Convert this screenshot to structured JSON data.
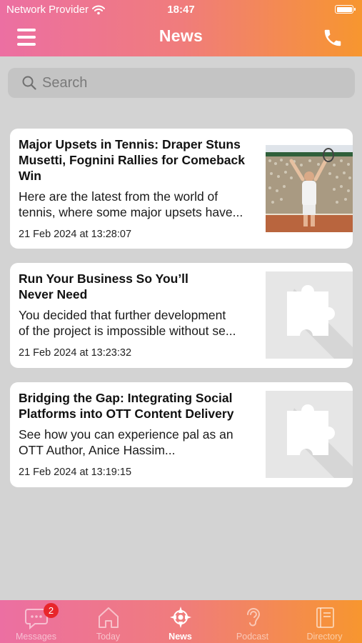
{
  "status_bar": {
    "carrier": "Network Provider",
    "time": "18:47"
  },
  "header": {
    "title": "News"
  },
  "search": {
    "placeholder": "Search"
  },
  "articles": [
    {
      "title": "Major Upsets in Tennis: Draper Stuns Musetti, Fognini Rallies for Comeback Win",
      "excerpt_line1": "Here are the latest from the world of",
      "excerpt_line2": "tennis, where some major upsets have...",
      "date": "21 Feb 2024 at 13:28:07",
      "thumbnail": "tennis-player-photo"
    },
    {
      "title": "Run Your Business So You’ll Never Need",
      "excerpt_line1": "You decided that further development",
      "excerpt_line2": "of the project is impossible without se...",
      "date": "21 Feb 2024 at 13:23:32",
      "thumbnail": "puzzle-piece-placeholder"
    },
    {
      "title": "Bridging the Gap: Integrating Social Platforms into OTT Content Delivery",
      "excerpt_line1": "See how you can experience pal as an",
      "excerpt_line2": "OTT Author, Anice Hassim...",
      "date": "21 Feb 2024 at 13:19:15",
      "thumbnail": "puzzle-piece-placeholder"
    }
  ],
  "tabbar": {
    "tabs": [
      {
        "label": "Messages",
        "icon": "chat-bubble-icon",
        "badge": "2"
      },
      {
        "label": "Today",
        "icon": "house-icon"
      },
      {
        "label": "News",
        "icon": "news-compass-icon",
        "active": true
      },
      {
        "label": "Podcast",
        "icon": "ear-icon"
      },
      {
        "label": "Directory",
        "icon": "book-icon"
      }
    ]
  },
  "colors": {
    "gradient_start": "#ec6fa2",
    "gradient_end": "#f7962f",
    "badge": "#e8262b",
    "background": "#d3d3d3"
  }
}
